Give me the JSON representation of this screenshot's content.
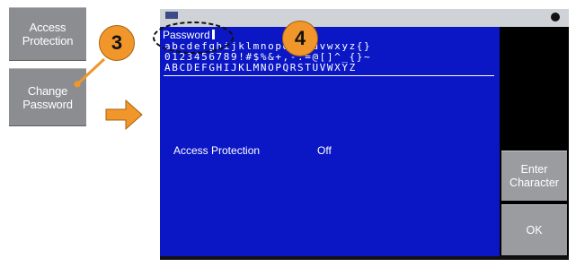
{
  "left_softkeys": [
    {
      "line1": "Access",
      "line2": "Protection"
    },
    {
      "line1": "Change",
      "line2": "Password"
    }
  ],
  "callouts": [
    "3",
    "4"
  ],
  "screen": {
    "password_label": "Password",
    "char_rows": [
      "abcdefghijklmnopqrstuvwxyz{}",
      "0123456789!#$%&+,-.=@[]^_{}~",
      "ABCDEFGHIJKLMNOPQRSTUVWXYZ"
    ],
    "status_label": "Access Protection",
    "status_value": "Off"
  },
  "right_softkeys": [
    {
      "line1": "Enter",
      "line2": "Character"
    },
    {
      "line1": "OK",
      "line2": ""
    }
  ],
  "colors": {
    "screen_bg": "#0b17c4",
    "callout": "#f0962a",
    "softkey": "#8b8d90"
  }
}
